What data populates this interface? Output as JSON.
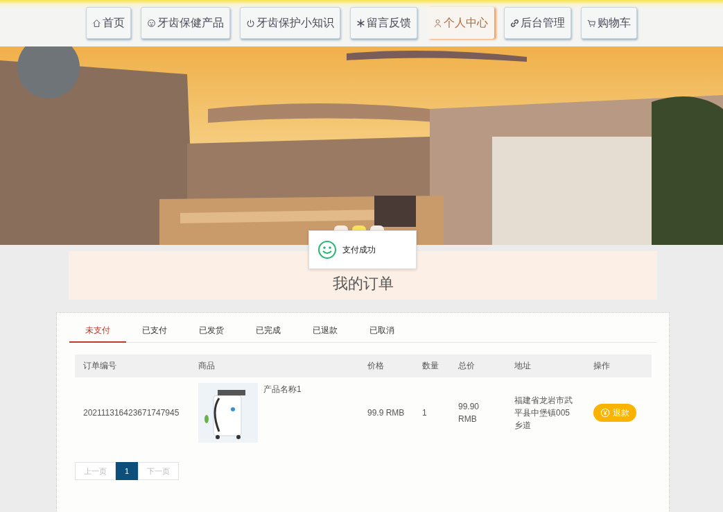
{
  "nav": [
    {
      "label": "首页",
      "selected": false
    },
    {
      "label": "牙齿保健产品",
      "selected": false
    },
    {
      "label": "牙齿保护小知识",
      "selected": false
    },
    {
      "label": "留言反馈",
      "selected": false
    },
    {
      "label": "个人中心",
      "selected": true
    },
    {
      "label": "后台管理",
      "selected": false
    },
    {
      "label": "购物车",
      "selected": false
    }
  ],
  "banner": {
    "dots": [
      {
        "selected": false
      },
      {
        "selected": true
      },
      {
        "selected": false
      }
    ]
  },
  "toast": {
    "message": "支付成功"
  },
  "heading": {
    "title": "我的订单"
  },
  "tabs": [
    {
      "label": "未支付",
      "selected": true
    },
    {
      "label": "已支付",
      "selected": false
    },
    {
      "label": "已发货",
      "selected": false
    },
    {
      "label": "已完成",
      "selected": false
    },
    {
      "label": "已退款",
      "selected": false
    },
    {
      "label": "已取消",
      "selected": false
    }
  ],
  "table": {
    "columns": [
      "订单编号",
      "商品",
      "价格",
      "数量",
      "总价",
      "地址",
      "操作"
    ],
    "rows": [
      {
        "order_no": "202111316423671747945",
        "product": "产品名称1",
        "price": "99.9 RMB",
        "quantity": "1",
        "total": "99.90 RMB",
        "address": "福建省龙岩市武平县中堡镇005乡道",
        "action": "退款"
      }
    ]
  },
  "pagination": {
    "prev": "上一页",
    "pages": [
      {
        "label": "1",
        "selected": true
      }
    ],
    "next": "下一页"
  }
}
